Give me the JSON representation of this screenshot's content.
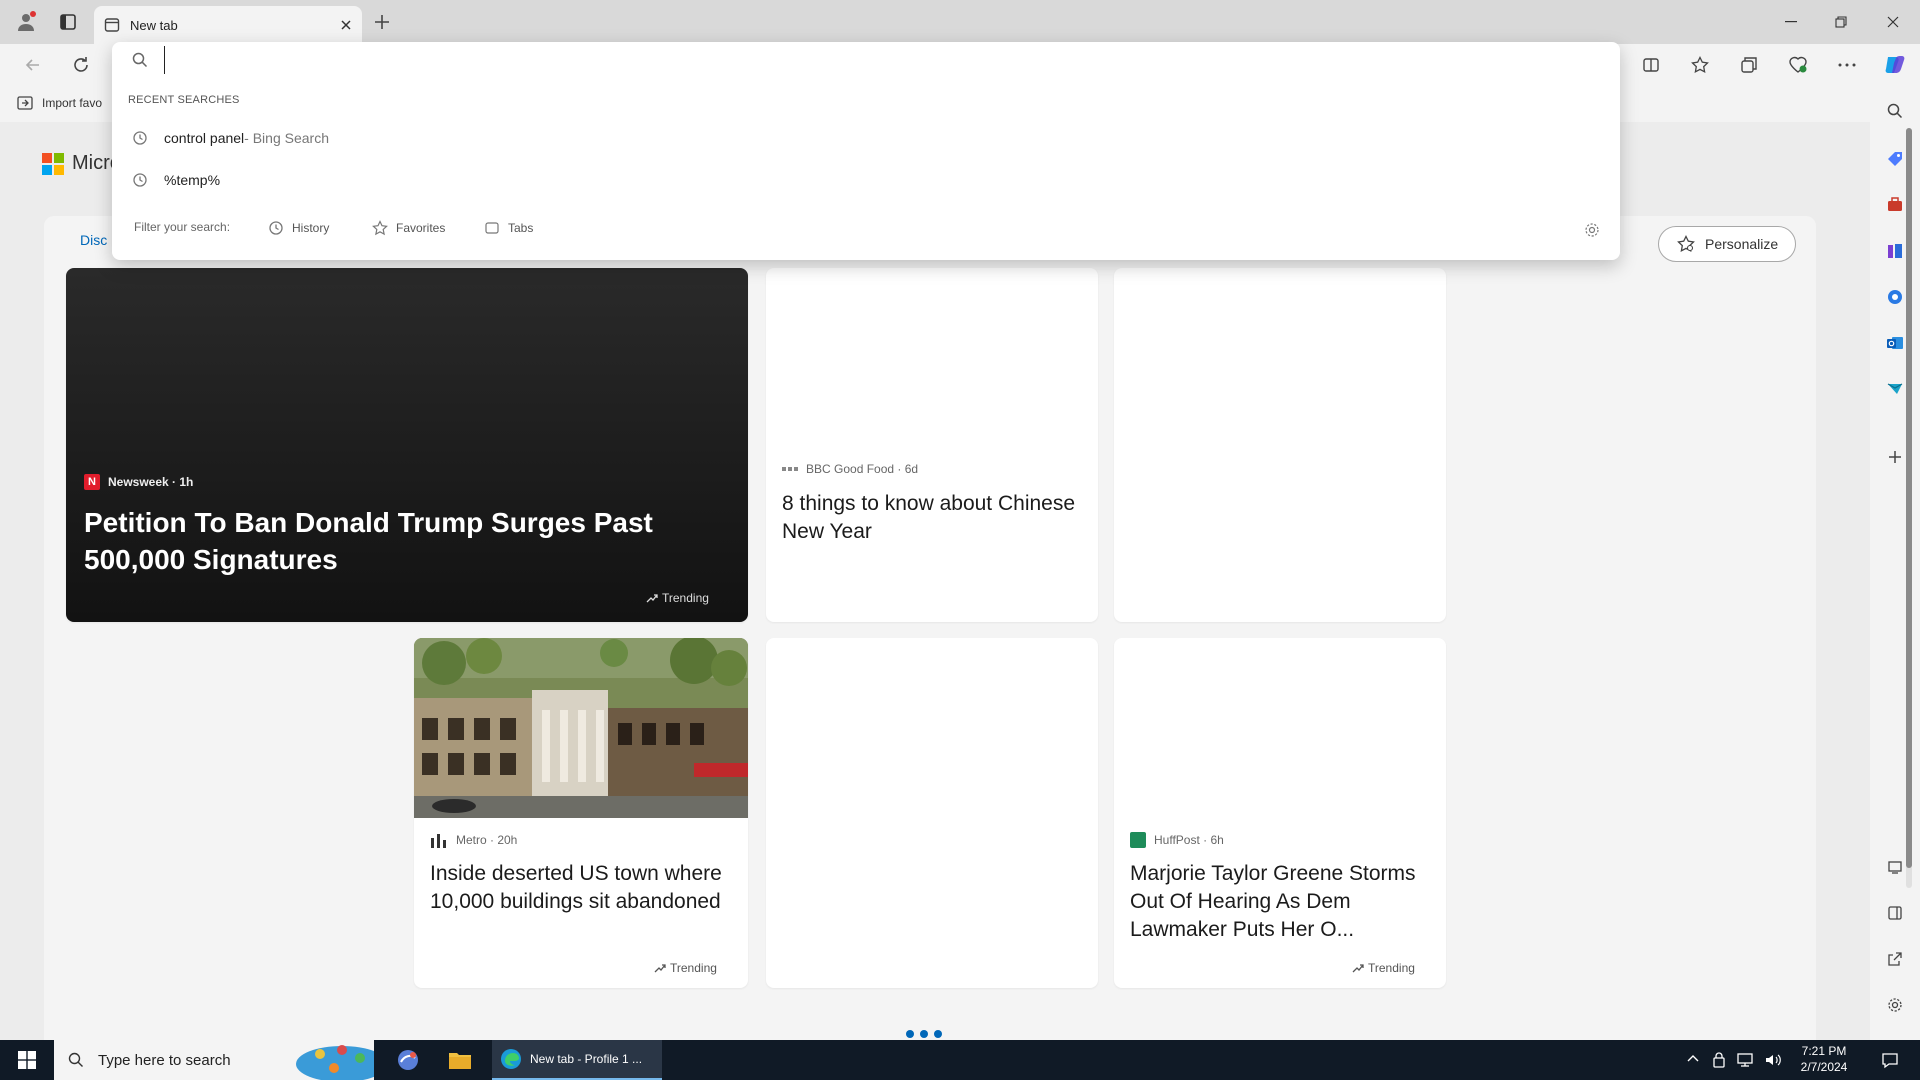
{
  "browser": {
    "tab": {
      "title": "New tab"
    },
    "favorites_bar": {
      "import_label": "Import favo"
    }
  },
  "address_dropdown": {
    "input_value": "",
    "recent_header": "RECENT SEARCHES",
    "recent_items": [
      {
        "query": "control panel",
        "suffix": " - Bing Search"
      },
      {
        "query": "%temp%",
        "suffix": ""
      }
    ],
    "filter_label": "Filter your search:",
    "filters": [
      {
        "label": "History",
        "icon": "history-icon"
      },
      {
        "label": "Favorites",
        "icon": "star-icon"
      },
      {
        "label": "Tabs",
        "icon": "tabs-icon"
      }
    ]
  },
  "newtab": {
    "logo_text": "Micro",
    "discover_tab": "Disc",
    "personalize_label": "Personalize",
    "cards": [
      {
        "source": "Newsweek · 1h",
        "headline": "Petition To Ban Donald Trump Surges Past 500,000 Signatures",
        "trend": "Trending"
      },
      {
        "source": "BBC Good Food · 6d",
        "headline": "8 things to know about Chinese New Year",
        "trend": ""
      },
      {
        "source": "Metro · 20h",
        "headline": "Inside deserted US town where 10,000 buildings sit abandoned",
        "trend": "Trending"
      },
      {
        "source": "HuffPost · 6h",
        "headline": "Marjorie Taylor Greene Storms Out Of Hearing As Dem Lawmaker Puts Her O...",
        "trend": "Trending"
      }
    ]
  },
  "taskbar": {
    "search_placeholder": "Type here to search",
    "edge_task_label": "New tab - Profile 1 ...",
    "time": "7:21 PM",
    "date": "2/7/2024"
  },
  "colors": {
    "accent": "#0078d4",
    "taskbar": "#101a26",
    "card_dark": "#1f1f1f",
    "newsweek_red": "#e11d2c",
    "huffpost_green": "#1e8c5a"
  }
}
